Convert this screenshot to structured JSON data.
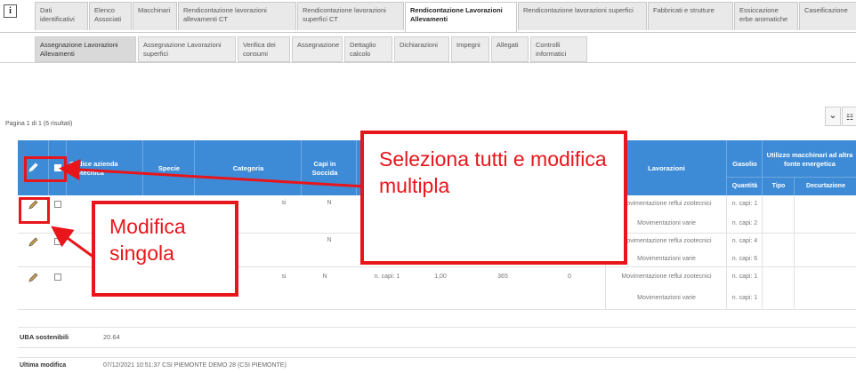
{
  "tabs_top": [
    {
      "label": "Dati identificativi"
    },
    {
      "label": "Elenco Associati"
    },
    {
      "label": "Macchinari"
    },
    {
      "label": "Rendicontazione lavorazioni allevamenti CT"
    },
    {
      "label": "Rendicontazione lavorazioni superfici CT"
    },
    {
      "label": "Rendicontazione Lavorazioni Allevamenti",
      "active": true
    },
    {
      "label": "Rendicontazione lavorazioni superfici"
    },
    {
      "label": "Fabbricati e strutture"
    },
    {
      "label": "Essiccazione erbe aromatiche"
    },
    {
      "label": "Caseificazione"
    }
  ],
  "tabs_sub": [
    {
      "label": "Assegnazione Lavorazioni Allevamenti",
      "active": true
    },
    {
      "label": "Assegnazione Lavorazioni superfici"
    },
    {
      "label": "Verifica dei consumi"
    },
    {
      "label": "Assegnazione"
    },
    {
      "label": "Dettaglio calcolo"
    },
    {
      "label": "Dichiarazioni"
    },
    {
      "label": "Impegni"
    },
    {
      "label": "Allegati"
    },
    {
      "label": "Controlli informatici"
    }
  ],
  "toolbar": {
    "chevron": "⌄",
    "columns": "☷"
  },
  "pagination": "Pagina 1 di 1 (6 risultati)",
  "table": {
    "headers": {
      "codice": "Codice azienda zootecnica",
      "specie": "Specie",
      "categoria": "Categoria",
      "capi_soccida": "Capi in Soccida",
      "lavorazioni": "Lavorazioni",
      "gasolio": "Gasolio",
      "quantita": "Quantità",
      "utilizzo": "Utilizzo macchinari ad altra fonte energetica",
      "tipo": "Tipo",
      "decurtazione": "Decurtazione"
    },
    "rows": [
      {
        "categoria_suffix": "si",
        "soccida": "N",
        "capi": "",
        "coeff": "",
        "giorni": "",
        "val": "",
        "lavorazioni": [
          "Movimentazione reflui zootecnici",
          "Movimentazioni varie"
        ],
        "gasolio": [
          "n. capi: 1",
          "n. capi: 2"
        ]
      },
      {
        "categoria_suffix": "",
        "soccida": "N",
        "capi": "",
        "coeff": "",
        "giorni": "",
        "val": "",
        "lavorazioni": [
          "Movimentazione reflui zootecnici",
          "Movimentazioni varie"
        ],
        "gasolio": [
          "n. capi: 4",
          "n. capi: 6"
        ]
      },
      {
        "categoria_suffix": "si",
        "soccida": "N",
        "capi": "n. capi: 1",
        "coeff": "1,00",
        "giorni": "365",
        "val": "0",
        "lavorazioni": [
          "Movimentazione reflui zootecnici",
          "Movimentazioni varie"
        ],
        "gasolio": [
          "n. capi: 1",
          "n. capi: 1"
        ]
      }
    ]
  },
  "summary": {
    "uba_label": "UBA sostenibili",
    "uba_value": "20.64",
    "last_label": "Ultima modifica",
    "last_value": "07/12/2021 10:51:37 CSI PIEMONTE DEMO 28 (CSI PIEMONTE)"
  },
  "annotations": {
    "select_all": "Seleziona tutti e modifica multipla",
    "single_edit": "Modifica singola"
  },
  "colors": {
    "header_blue": "#3d8bd6",
    "annotation_red": "#e8151b"
  }
}
